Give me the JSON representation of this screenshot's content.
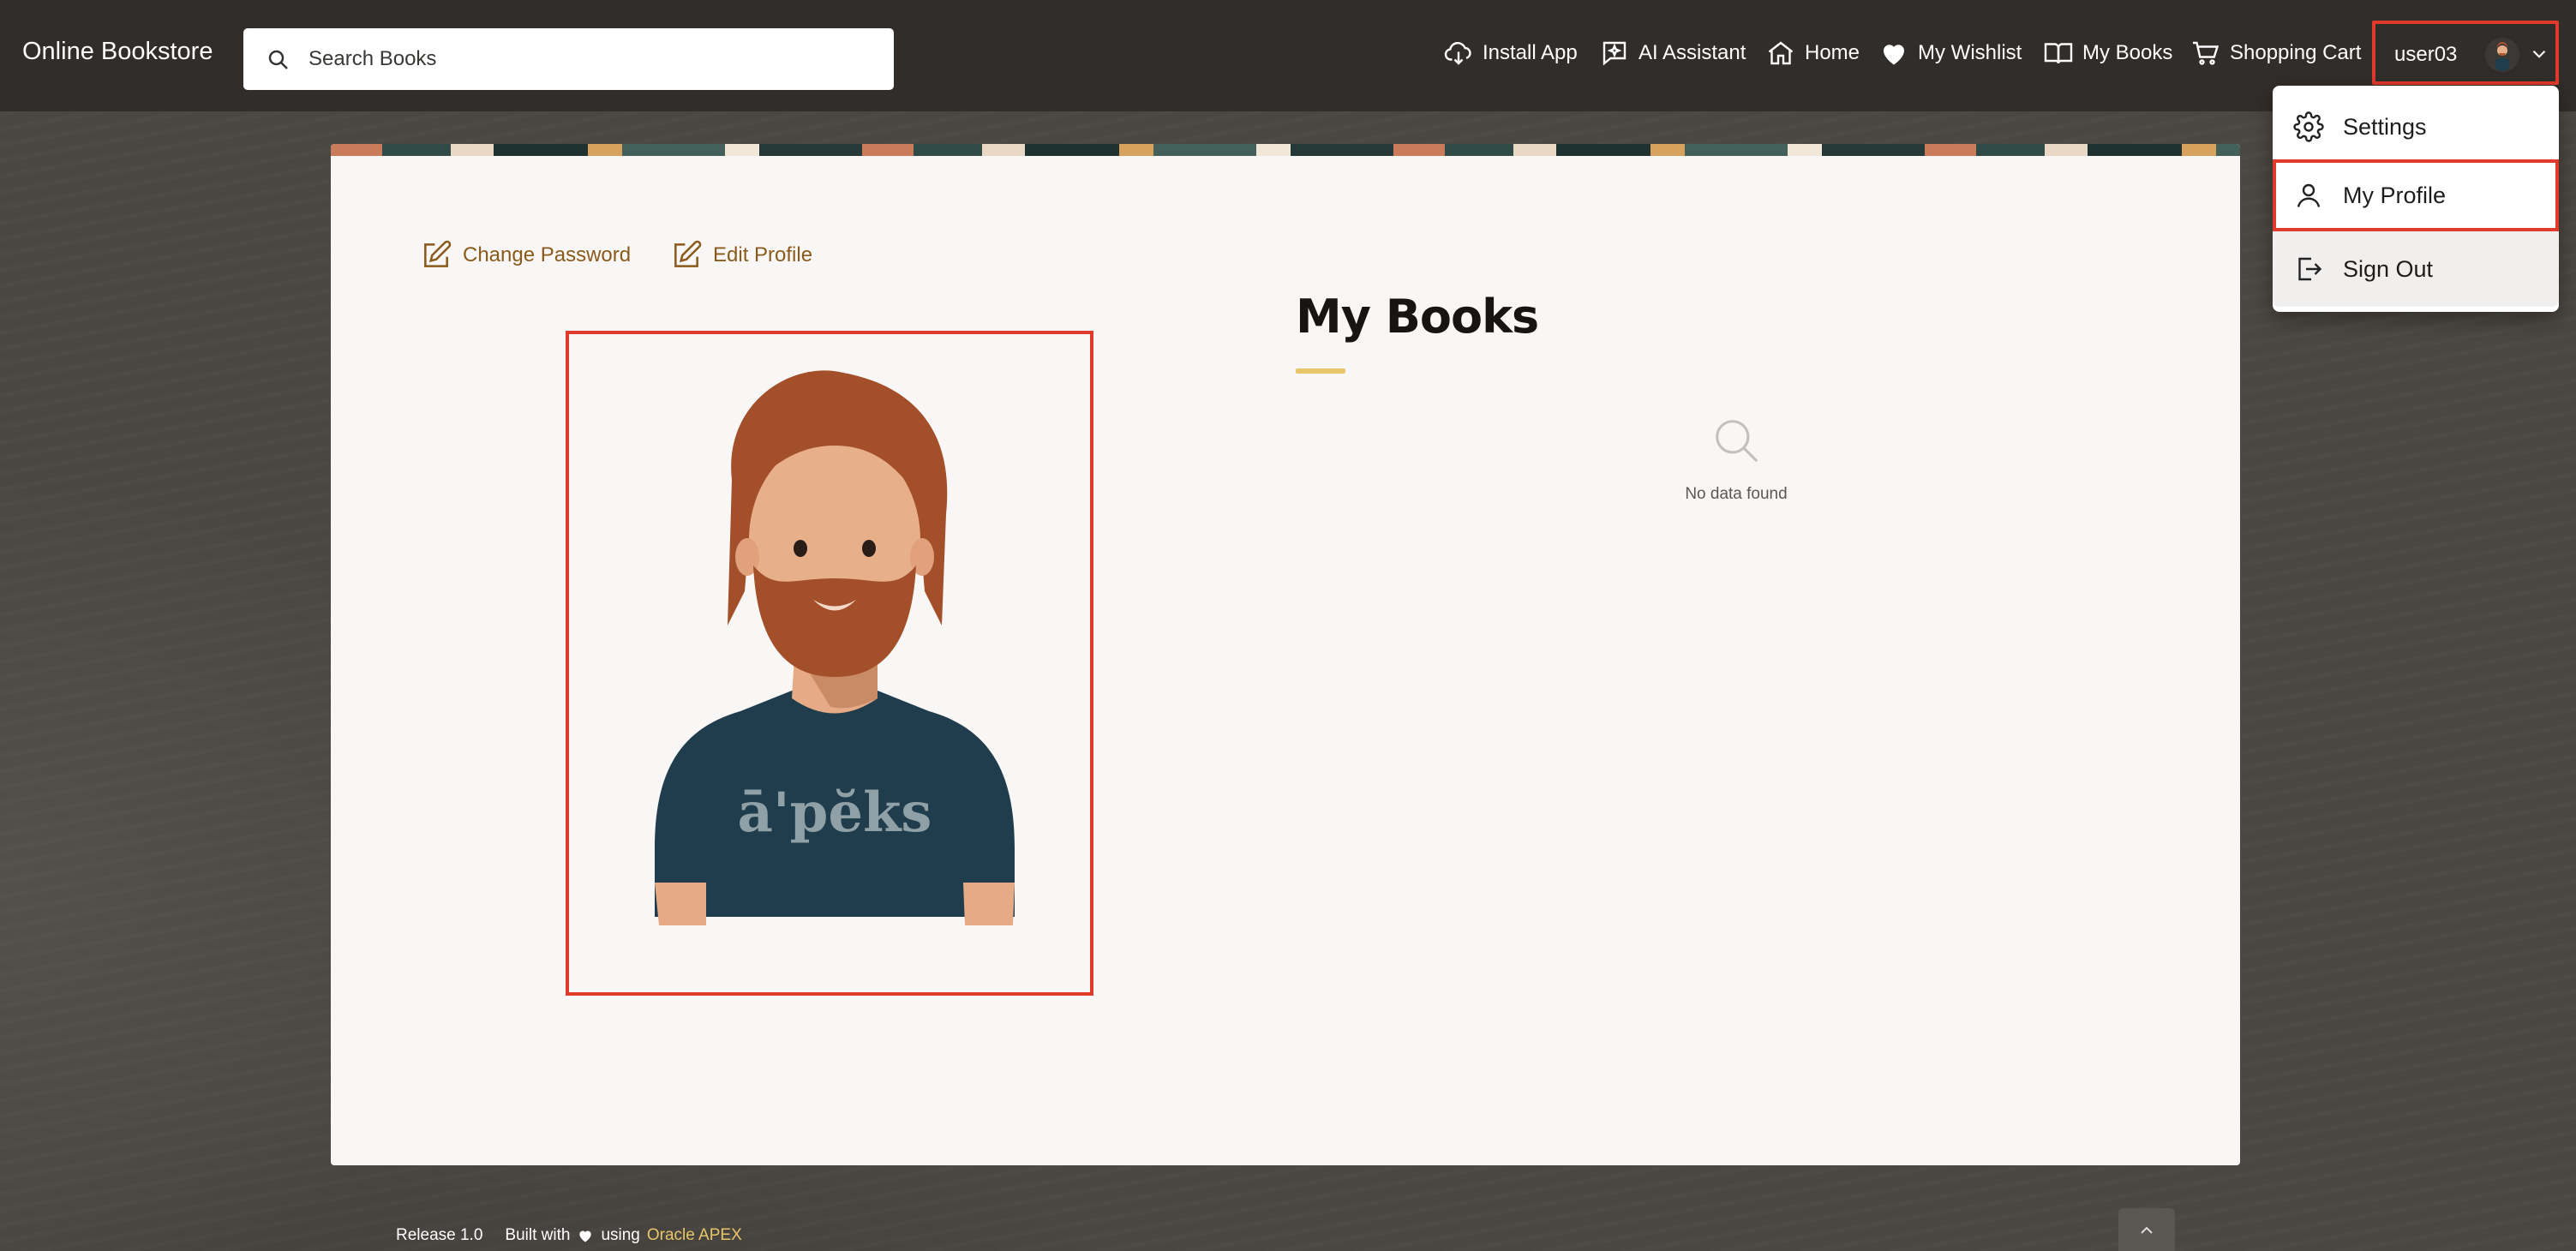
{
  "header": {
    "brand": "Online Bookstore",
    "search_placeholder": "Search Books",
    "nav": [
      {
        "label": "Install App",
        "icon": "cloud-download-icon"
      },
      {
        "label": "AI Assistant",
        "icon": "ai-chat-icon"
      },
      {
        "label": "Home",
        "icon": "home-icon"
      },
      {
        "label": "My Wishlist",
        "icon": "heart-icon"
      },
      {
        "label": "My Books",
        "icon": "open-book-icon"
      },
      {
        "label": "Shopping Cart",
        "icon": "cart-icon"
      }
    ],
    "username": "user03"
  },
  "user_dropdown": {
    "items": [
      {
        "label": "Settings",
        "icon": "gear-icon"
      },
      {
        "label": "My Profile",
        "icon": "person-icon"
      },
      {
        "label": "Sign Out",
        "icon": "sign-out-icon"
      }
    ]
  },
  "profile": {
    "actions": [
      {
        "label": "Change Password",
        "icon": "edit-icon"
      },
      {
        "label": "Edit Profile",
        "icon": "edit-icon"
      }
    ],
    "avatar_shirt_text": "ā'pĕks"
  },
  "my_books": {
    "title": "My Books",
    "empty_message": "No data found"
  },
  "footer": {
    "release": "Release 1.0",
    "built_with": "Built with",
    "using": "using",
    "apex_link": "Oracle APEX"
  },
  "colors": {
    "header_bg": "#312d2a",
    "highlight": "#e03a2b",
    "accent_link": "#8a5a1a",
    "title_underline": "#e8c66a"
  }
}
